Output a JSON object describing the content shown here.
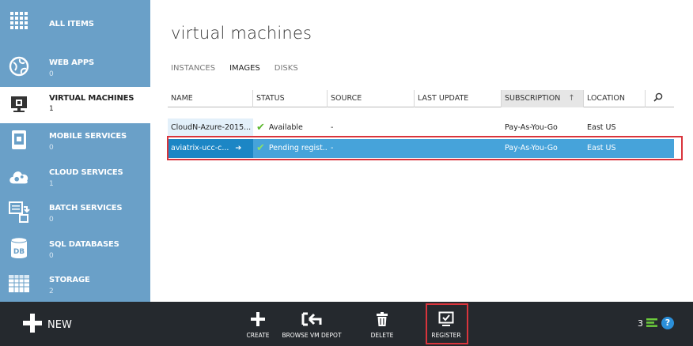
{
  "sidebar": {
    "items": [
      {
        "label": "ALL ITEMS",
        "count": ""
      },
      {
        "label": "WEB APPS",
        "count": "0"
      },
      {
        "label": "VIRTUAL MACHINES",
        "count": "1"
      },
      {
        "label": "MOBILE SERVICES",
        "count": "0"
      },
      {
        "label": "CLOUD SERVICES",
        "count": "1"
      },
      {
        "label": "BATCH SERVICES",
        "count": "0"
      },
      {
        "label": "SQL DATABASES",
        "count": "0"
      },
      {
        "label": "STORAGE",
        "count": "2"
      }
    ],
    "db_icon_text": "DB"
  },
  "main": {
    "title": "virtual machines",
    "tabs": [
      "INSTANCES",
      "IMAGES",
      "DISKS"
    ],
    "columns": [
      "NAME",
      "STATUS",
      "SOURCE",
      "LAST UPDATE",
      "SUBSCRIPTION",
      "LOCATION"
    ],
    "rows": [
      {
        "name": "CloudN-Azure-2015...",
        "status": "Available",
        "source": "-",
        "last_update": "",
        "subscription": "Pay-As-You-Go",
        "location": "East US"
      },
      {
        "name": "aviatrix-ucc-c...",
        "status": "Pending regist...",
        "source": "-",
        "last_update": "",
        "subscription": "Pay-As-You-Go",
        "location": "East US"
      }
    ]
  },
  "bottombar": {
    "new_label": "NEW",
    "commands": [
      "CREATE",
      "BROWSE VM DEPOT",
      "DELETE",
      "REGISTER"
    ],
    "notification_count": "3",
    "help": "?"
  }
}
